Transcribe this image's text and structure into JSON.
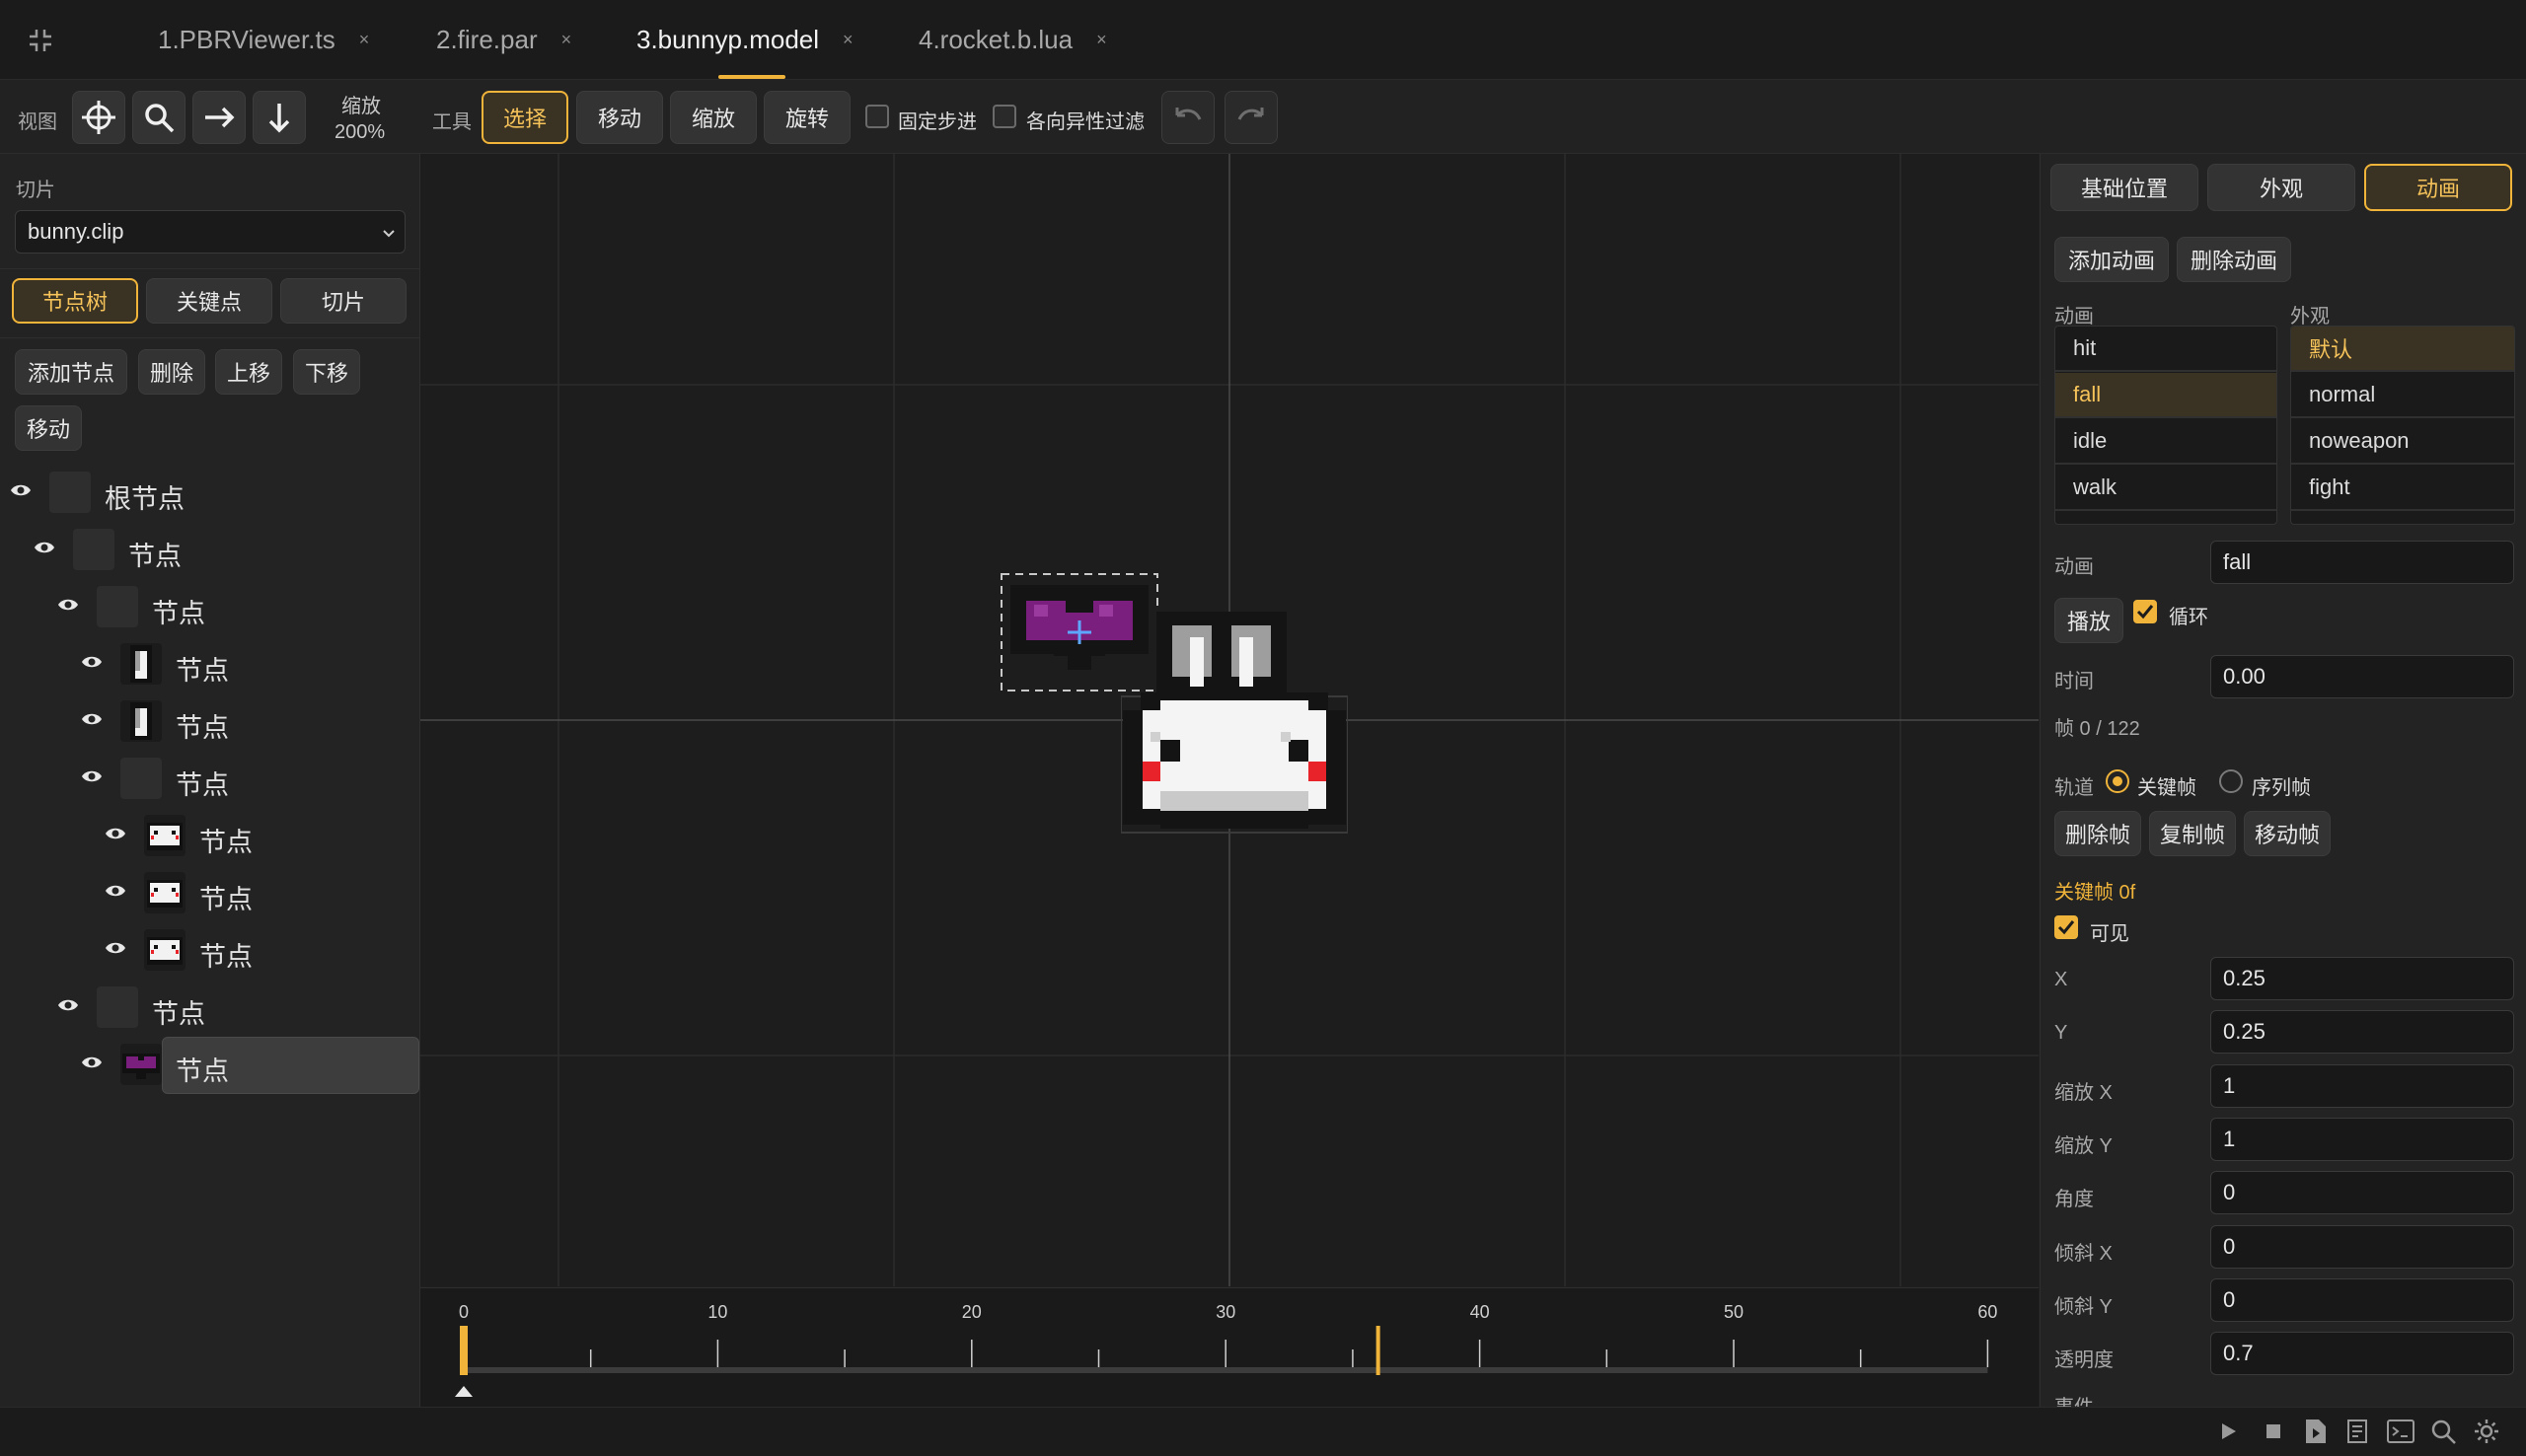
{
  "tabs": [
    {
      "label": "1.PBRViewer.ts",
      "active": false
    },
    {
      "label": "2.fire.par",
      "active": false
    },
    {
      "label": "3.bunnyp.model",
      "active": true
    },
    {
      "label": "4.rocket.b.lua",
      "active": false
    }
  ],
  "close_glyph": "×",
  "toolbar": {
    "view_label": "视图",
    "zoom_label": "缩放",
    "zoom_value": "200%",
    "tools_label": "工具",
    "tool_select": "选择",
    "tool_move": "移动",
    "tool_scale": "缩放",
    "tool_rotate": "旋转",
    "fixed_step": "固定步进",
    "anisotropic": "各向异性过滤"
  },
  "left": {
    "clip_label": "切片",
    "clip_value": "bunny.clip",
    "tab_tree": "节点树",
    "tab_keyframes": "关键点",
    "tab_slices": "切片",
    "add_node": "添加节点",
    "delete": "删除",
    "move_up": "上移",
    "move_down": "下移",
    "move": "移动",
    "tree": [
      {
        "label": "根节点",
        "depth": 0,
        "thumb": "empty"
      },
      {
        "label": "节点",
        "depth": 1,
        "thumb": "empty"
      },
      {
        "label": "节点",
        "depth": 2,
        "thumb": "empty"
      },
      {
        "label": "节点",
        "depth": 3,
        "thumb": "ear"
      },
      {
        "label": "节点",
        "depth": 3,
        "thumb": "ear"
      },
      {
        "label": "节点",
        "depth": 3,
        "thumb": "empty"
      },
      {
        "label": "节点",
        "depth": 4,
        "thumb": "face"
      },
      {
        "label": "节点",
        "depth": 4,
        "thumb": "face"
      },
      {
        "label": "节点",
        "depth": 4,
        "thumb": "face"
      },
      {
        "label": "节点",
        "depth": 2,
        "thumb": "empty"
      },
      {
        "label": "节点",
        "depth": 3,
        "thumb": "heart",
        "selected": true
      }
    ]
  },
  "timeline": {
    "ticks": [
      "0",
      "10",
      "20",
      "30",
      "40",
      "50",
      "60"
    ],
    "current_frame": 0,
    "marker_frame": 36
  },
  "right": {
    "tab_base": "基础位置",
    "tab_look": "外观",
    "tab_anim": "动画",
    "add_anim": "添加动画",
    "delete_anim": "删除动画",
    "anim_list_label": "动画",
    "look_list_label": "外观",
    "animations": [
      "hit",
      "fall",
      "idle",
      "walk"
    ],
    "selected_animation": "fall",
    "looks": [
      "默认",
      "normal",
      "noweapon",
      "fight"
    ],
    "selected_look": "默认",
    "anim_field_label": "动画",
    "anim_field_value": "fall",
    "play": "播放",
    "loop": "循环",
    "loop_checked": true,
    "time_label": "时间",
    "time_value": "0.00",
    "frame_info": "帧 0 / 122",
    "track_label": "轨道",
    "track_keyframe": "关键帧",
    "track_sequence": "序列帧",
    "delete_frame": "删除帧",
    "copy_frame": "复制帧",
    "move_frame": "移动帧",
    "keyframe_title": "关键帧 0f",
    "visible": "可见",
    "visible_checked": true,
    "props": [
      {
        "label": "X",
        "value": "0.25"
      },
      {
        "label": "Y",
        "value": "0.25"
      },
      {
        "label": "缩放 X",
        "value": "1"
      },
      {
        "label": "缩放 Y",
        "value": "1"
      },
      {
        "label": "角度",
        "value": "0"
      },
      {
        "label": "倾斜 X",
        "value": "0"
      },
      {
        "label": "倾斜 Y",
        "value": "0"
      },
      {
        "label": "透明度",
        "value": "0.7"
      }
    ],
    "cut_label": "事件"
  },
  "colors": {
    "accent": "#f0b43a",
    "purple": "#7a1f7d",
    "blush": "#e8242a"
  },
  "status_icons": [
    "play-icon",
    "stop-icon",
    "file-play-icon",
    "document-icon",
    "terminal-icon",
    "search-icon",
    "gear-icon"
  ]
}
